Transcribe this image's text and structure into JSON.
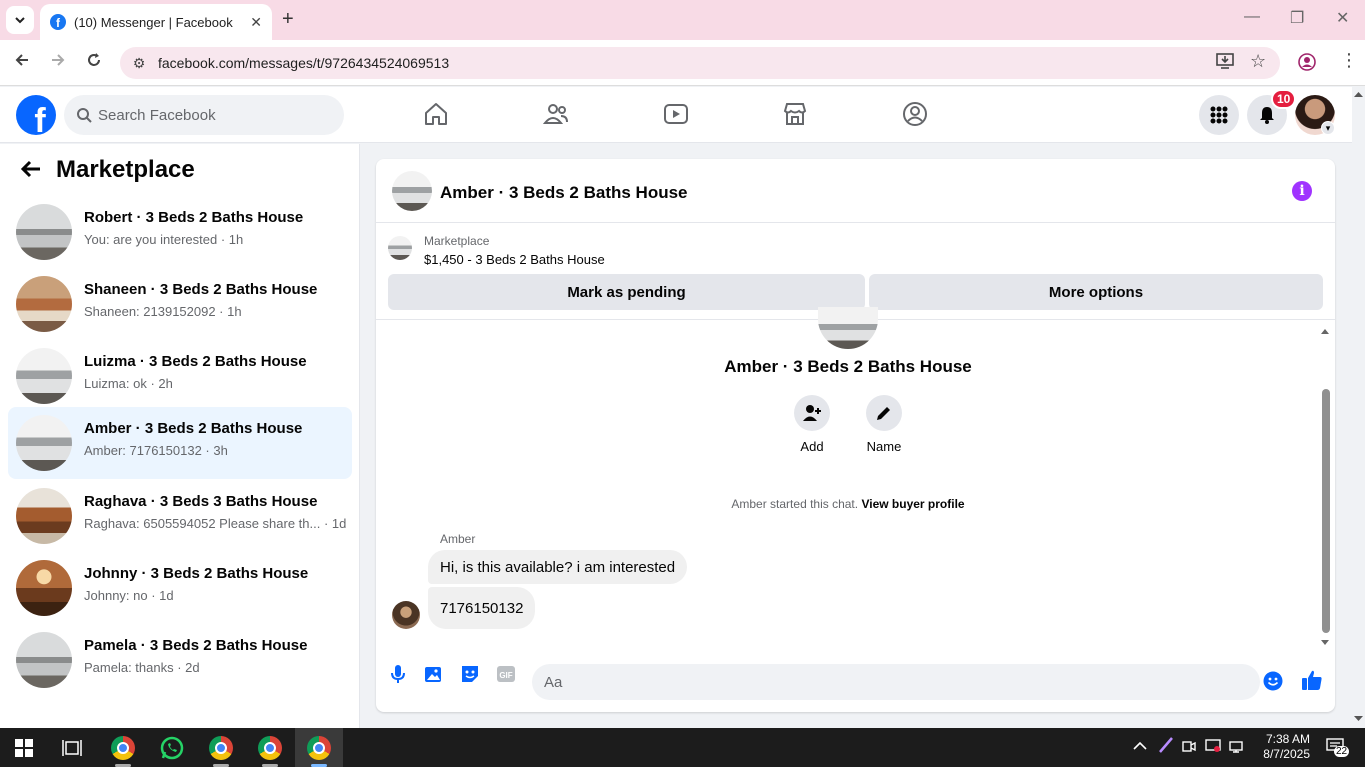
{
  "browser": {
    "tab_title": "(10) Messenger | Facebook",
    "url": "facebook.com/messages/t/9726434524069513"
  },
  "header": {
    "search_placeholder": "Search Facebook",
    "notification_count": "10"
  },
  "sidebar": {
    "title": "Marketplace",
    "conversations": [
      {
        "name": "Robert · 3 Beds 2 Baths House",
        "preview": "You: are you interested · 1h",
        "thumb": "th-grey"
      },
      {
        "name": "Shaneen · 3 Beds 2 Baths House",
        "preview": "Shaneen: 2139152092 · 1h",
        "thumb": "th-orange"
      },
      {
        "name": "Luizma · 3 Beds 2 Baths House",
        "preview": "Luizma: ok · 2h",
        "thumb": "th-white"
      },
      {
        "name": "Amber · 3 Beds 2 Baths House",
        "preview": "Amber: 7176150132 · 3h",
        "thumb": "th-white"
      },
      {
        "name": "Raghava · 3 Beds 3 Baths House",
        "preview": "Raghava: 6505594052 Please share th... · 1d",
        "thumb": "th-wood"
      },
      {
        "name": "Johnny · 3 Beds 2 Baths House",
        "preview": "Johnny: no · 1d",
        "thumb": "th-dining"
      },
      {
        "name": "Pamela · 3 Beds 2 Baths House",
        "preview": "Pamela: thanks · 2d",
        "thumb": "th-grey"
      }
    ]
  },
  "chat": {
    "title": "Amber · 3 Beds 2 Baths House",
    "listing_source": "Marketplace",
    "listing_desc": "$1,450 - 3 Beds 2 Baths House",
    "mark_pending_label": "Mark as pending",
    "more_options_label": "More options",
    "intro_name": "Amber · 3 Beds 2 Baths House",
    "add_label": "Add",
    "name_label": "Name",
    "started_text": "Amber started this chat.",
    "view_profile_label": "View buyer profile",
    "sender": "Amber",
    "messages": [
      "Hi, is this available? i am interested",
      "7176150132"
    ],
    "composer_placeholder": "Aa"
  },
  "taskbar": {
    "time": "7:38 AM",
    "date": "8/7/2025",
    "notifications": "22"
  },
  "colors": {
    "facebook_blue": "#0866ff",
    "active_conversation": "#ebf5ff",
    "messenger_purple": "#a033ff",
    "badge_red": "#e41e3f"
  }
}
